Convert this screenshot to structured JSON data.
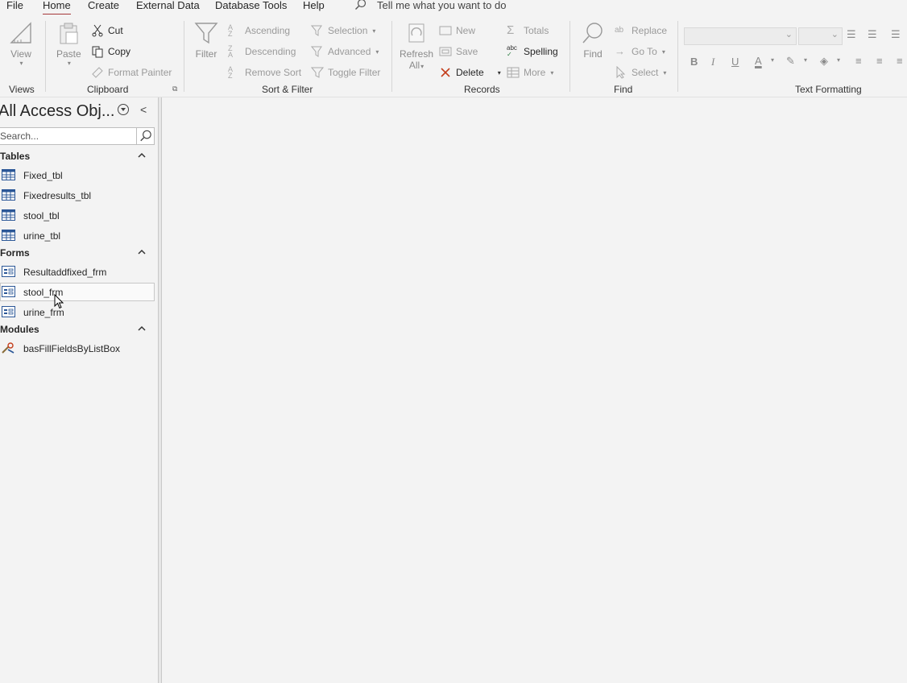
{
  "menu": {
    "tabs": [
      "File",
      "Home",
      "Create",
      "External Data",
      "Database Tools",
      "Help"
    ],
    "active": "Home",
    "tellme": "Tell me what you want to do"
  },
  "ribbon": {
    "views": {
      "label": "Views",
      "view": "View"
    },
    "clipboard": {
      "label": "Clipboard",
      "paste": "Paste",
      "cut": "Cut",
      "copy": "Copy",
      "format_painter": "Format Painter"
    },
    "sort_filter": {
      "label": "Sort & Filter",
      "filter": "Filter",
      "ascending": "Ascending",
      "descending": "Descending",
      "remove_sort": "Remove Sort",
      "selection": "Selection",
      "advanced": "Advanced",
      "toggle_filter": "Toggle Filter"
    },
    "records": {
      "label": "Records",
      "refresh": "Refresh",
      "refresh_sub": "All",
      "new": "New",
      "save": "Save",
      "delete": "Delete",
      "totals": "Totals",
      "spelling": "Spelling",
      "more": "More"
    },
    "find": {
      "label": "Find",
      "find": "Find",
      "replace": "Replace",
      "goto": "Go To",
      "select": "Select"
    },
    "text_formatting": {
      "label": "Text Formatting",
      "bold": "B",
      "italic": "I",
      "underline": "U",
      "font_color": "A"
    }
  },
  "nav": {
    "title": "All Access Obj...",
    "search_placeholder": "Search...",
    "sections": [
      {
        "name": "Tables",
        "items": [
          "Fixed_tbl",
          "Fixedresults_tbl",
          "stool_tbl",
          "urine_tbl"
        ]
      },
      {
        "name": "Forms",
        "items": [
          "Resultaddfixed_frm",
          "stool_frm",
          "urine_frm"
        ]
      },
      {
        "name": "Modules",
        "items": [
          "basFillFieldsByListBox"
        ]
      }
    ]
  },
  "colors": {
    "accent": "#a4373a",
    "table_icon": "#2b5797",
    "background": "#f3f3f3"
  }
}
